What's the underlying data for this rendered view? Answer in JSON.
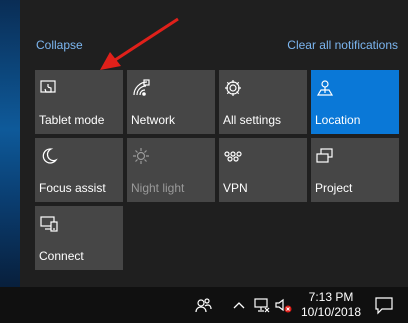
{
  "header": {
    "collapse_label": "Collapse",
    "clear_label": "Clear all notifications"
  },
  "tiles": [
    {
      "label": "Tablet mode",
      "icon": "tablet-mode-icon",
      "state": "off"
    },
    {
      "label": "Network",
      "icon": "network-icon",
      "state": "off"
    },
    {
      "label": "All settings",
      "icon": "settings-gear-icon",
      "state": "off"
    },
    {
      "label": "Location",
      "icon": "location-icon",
      "state": "on"
    },
    {
      "label": "Focus assist",
      "icon": "moon-icon",
      "state": "off"
    },
    {
      "label": "Night light",
      "icon": "sun-icon",
      "state": "disabled"
    },
    {
      "label": "VPN",
      "icon": "vpn-icon",
      "state": "off"
    },
    {
      "label": "Project",
      "icon": "project-icon",
      "state": "off"
    },
    {
      "label": "Connect",
      "icon": "connect-icon",
      "state": "off"
    }
  ],
  "taskbar": {
    "time": "7:13 PM",
    "date": "10/10/2018",
    "tray_icons": [
      "people-icon",
      "chevron-up-icon",
      "network-disconnected-icon",
      "volume-muted-icon"
    ],
    "notification_icon": "action-center-icon"
  },
  "colors": {
    "panel": "#1f1f1f",
    "tile": "#464646",
    "tile_active": "#0a78d7",
    "link": "#7cb6f0",
    "arrow": "#e0201a"
  }
}
